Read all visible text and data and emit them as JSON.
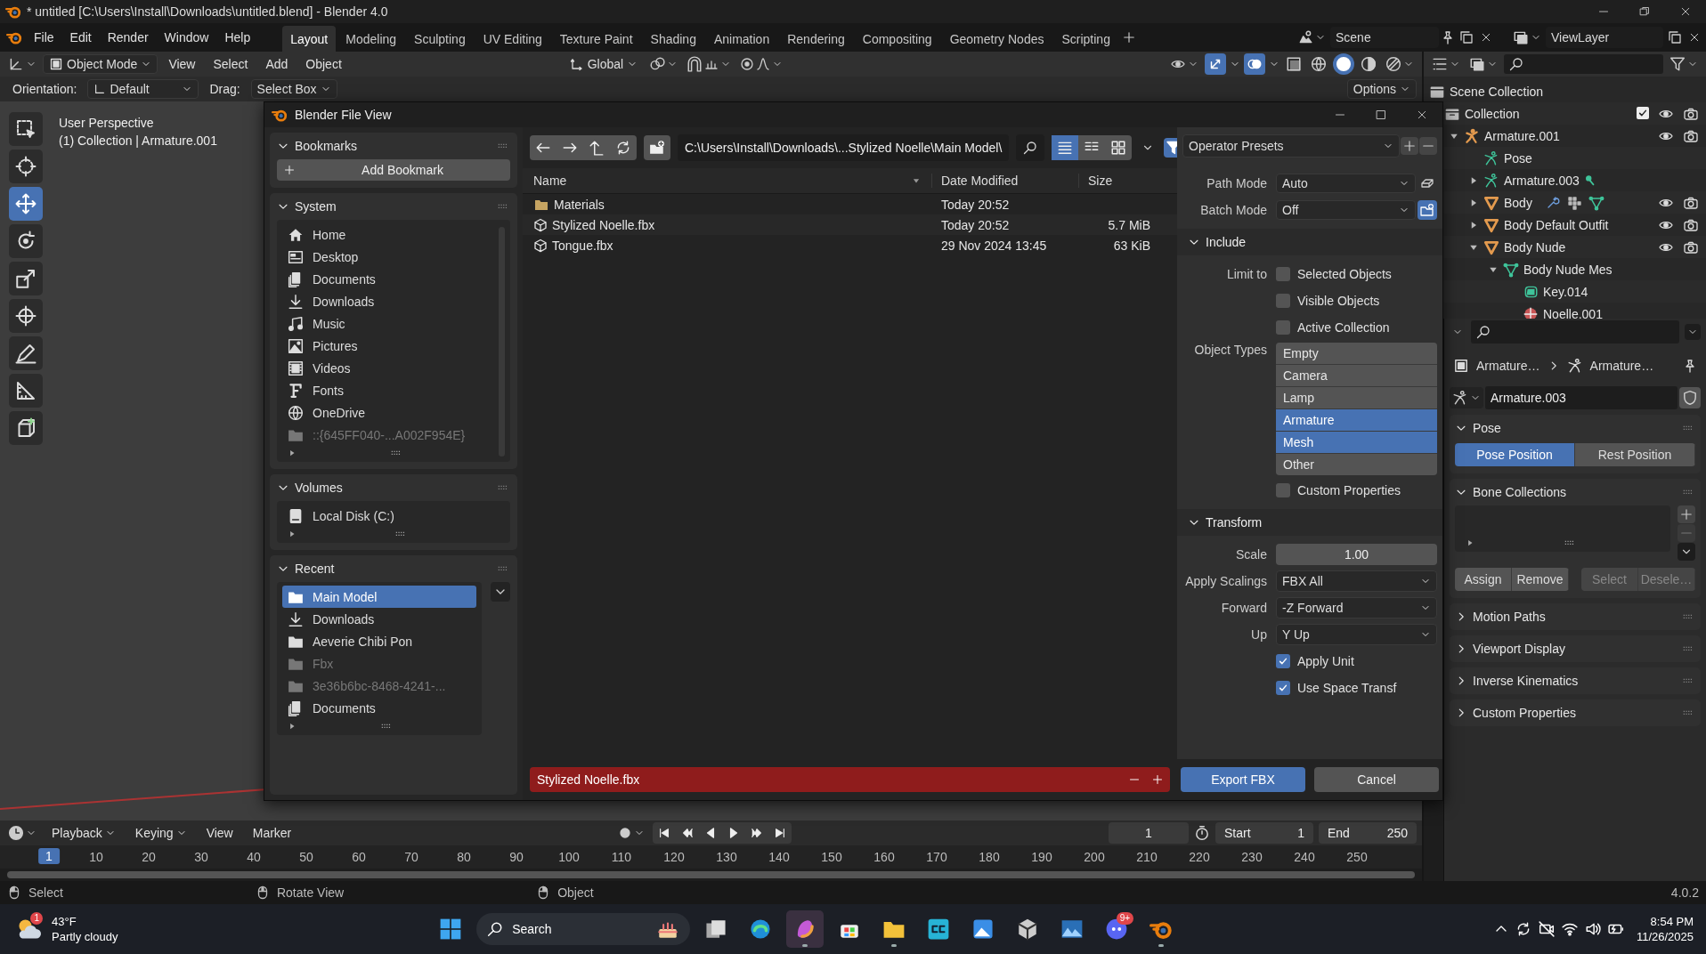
{
  "window": {
    "title": "* untitled [C:\\Users\\Install\\Downloads\\untitled.blend] - Blender 4.0"
  },
  "menu": [
    "File",
    "Edit",
    "Render",
    "Window",
    "Help"
  ],
  "workspaces": [
    {
      "label": "Layout",
      "selected": true
    },
    {
      "label": "Modeling",
      "selected": false
    },
    {
      "label": "Sculpting",
      "selected": false
    },
    {
      "label": "UV Editing",
      "selected": false
    },
    {
      "label": "Texture Paint",
      "selected": false
    },
    {
      "label": "Shading",
      "selected": false
    },
    {
      "label": "Animation",
      "selected": false
    },
    {
      "label": "Rendering",
      "selected": false
    },
    {
      "label": "Compositing",
      "selected": false
    },
    {
      "label": "Geometry Nodes",
      "selected": false
    },
    {
      "label": "Scripting",
      "selected": false
    }
  ],
  "scene": "Scene",
  "view_layer": "ViewLayer",
  "viewport_header": {
    "mode": "Object Mode",
    "menus": [
      "View",
      "Select",
      "Add",
      "Object"
    ],
    "orientation": "Global"
  },
  "tool_settings": {
    "orientation_label": "Orientation:",
    "orientation": "Default",
    "drag_label": "Drag:",
    "drag": "Select Box",
    "options": "Options"
  },
  "tools": [
    {
      "kind": "select",
      "selected": false
    },
    {
      "kind": "cursor",
      "selected": false
    },
    {
      "kind": "move",
      "selected": true
    },
    {
      "kind": "rotate",
      "selected": false
    },
    {
      "kind": "scale",
      "selected": false
    },
    {
      "kind": "transform",
      "selected": false
    },
    {
      "kind": "annotate",
      "selected": false
    },
    {
      "kind": "measure",
      "selected": false
    },
    {
      "kind": "add_cube",
      "selected": false
    }
  ],
  "viewport": {
    "perspective": "User Perspective",
    "context": "(1) Collection | Armature.001"
  },
  "file_dialog": {
    "title": "Blender File View",
    "bookmarks": {
      "title": "Bookmarks",
      "expanded": true,
      "add": "Add Bookmark"
    },
    "system": {
      "title": "System",
      "expanded": true,
      "items": [
        {
          "label": "Home",
          "kind": "home",
          "disabled": false
        },
        {
          "label": "Desktop",
          "kind": "desktop",
          "disabled": false
        },
        {
          "label": "Documents",
          "kind": "documents",
          "disabled": false
        },
        {
          "label": "Downloads",
          "kind": "download",
          "disabled": false
        },
        {
          "label": "Music",
          "kind": "music",
          "disabled": false
        },
        {
          "label": "Pictures",
          "kind": "picture",
          "disabled": false
        },
        {
          "label": "Videos",
          "kind": "video",
          "disabled": false
        },
        {
          "label": "Fonts",
          "kind": "font",
          "disabled": false
        },
        {
          "label": "OneDrive",
          "kind": "globe",
          "disabled": false
        },
        {
          "label": "::{645FF040-...A002F954E}",
          "kind": "folder",
          "disabled": true
        }
      ]
    },
    "volumes": {
      "title": "Volumes",
      "expanded": true,
      "items": [
        {
          "label": "Local Disk (C:)",
          "kind": "disk",
          "disabled": false
        }
      ]
    },
    "recent": {
      "title": "Recent",
      "expanded": true,
      "items": [
        {
          "label": "Main Model",
          "kind": "folder",
          "selected": true,
          "disabled": false
        },
        {
          "label": "Downloads",
          "kind": "download",
          "selected": false,
          "disabled": false
        },
        {
          "label": "Aeverie Chibi Pon",
          "kind": "folder",
          "selected": false,
          "disabled": false
        },
        {
          "label": "Fbx",
          "kind": "folder",
          "selected": false,
          "disabled": true
        },
        {
          "label": "3e36b6bc-8468-4241-...",
          "kind": "folder",
          "selected": false,
          "disabled": true
        },
        {
          "label": "Documents",
          "kind": "documents",
          "selected": false,
          "disabled": false
        }
      ]
    },
    "path": "C:\\Users\\Install\\Downloads\\...Stylized Noelle\\Main Model\\",
    "columns": [
      "Name",
      "Date Modified",
      "Size"
    ],
    "files": [
      {
        "name": "Materials",
        "kind": "folder",
        "date": "Today 20:52"
      },
      {
        "name": "Stylized Noelle.fbx",
        "kind": "file",
        "date": "Today 20:52",
        "size": "5.7 MiB"
      },
      {
        "name": "Tongue.fbx",
        "kind": "file",
        "date": "29 Nov 2024 13:45",
        "size": "63 KiB"
      }
    ],
    "presets": "Operator Presets",
    "path_mode": {
      "label": "Path Mode",
      "value": "Auto"
    },
    "batch_mode": {
      "label": "Batch Mode",
      "value": "Off"
    },
    "include": {
      "title": "Include",
      "expanded": true,
      "limit_label": "Limit to",
      "limits": [
        {
          "label": "Selected Objects",
          "checked": false
        },
        {
          "label": "Visible Objects",
          "checked": false
        },
        {
          "label": "Active Collection",
          "checked": false
        }
      ],
      "types_label": "Object Types",
      "types": [
        {
          "label": "Empty",
          "selected": false
        },
        {
          "label": "Camera",
          "selected": false
        },
        {
          "label": "Lamp",
          "selected": false
        },
        {
          "label": "Armature",
          "selected": true
        },
        {
          "label": "Mesh",
          "selected": true
        },
        {
          "label": "Other",
          "selected": false
        }
      ],
      "custom_properties": {
        "label": "Custom Properties",
        "checked": false
      }
    },
    "transform": {
      "title": "Transform",
      "expanded": true,
      "fields": [
        {
          "kind": "number",
          "label": "Scale",
          "value": "1.00"
        },
        {
          "kind": "dropdown",
          "label": "Apply Scalings",
          "value": "FBX All"
        },
        {
          "kind": "dropdown",
          "label": "Forward",
          "value": "-Z Forward"
        },
        {
          "kind": "dropdown",
          "label": "Up",
          "value": "Y Up"
        }
      ],
      "checks": [
        {
          "label": "Apply Unit",
          "checked": true
        },
        {
          "label": "Use Space Transf",
          "checked": true
        }
      ]
    },
    "filename": "Stylized Noelle.fbx",
    "file_exists": true,
    "buttons": [
      {
        "label": "Export FBX",
        "primary": true
      },
      {
        "label": "Cancel",
        "primary": false
      }
    ]
  },
  "outliner": {
    "root": "Scene Collection",
    "tree": [
      {
        "label": "Collection",
        "kind": "collection",
        "checked": true,
        "show_toggles": true,
        "children": [
          {
            "label": "Armature.001",
            "kind": "armature",
            "expanded": true,
            "show_toggles": true,
            "children": [
              {
                "label": "Pose",
                "kind": "pose"
              },
              {
                "label": "Armature.003",
                "kind": "armature_data",
                "expanded": false,
                "bone_badge": true
              },
              {
                "label": "Body",
                "kind": "mesh_object",
                "expanded": false,
                "show_toggles": true,
                "modifiers": true
              },
              {
                "label": "Body Default Outfit",
                "kind": "mesh_object",
                "expanded": false,
                "show_toggles": true
              },
              {
                "label": "Body Nude",
                "kind": "mesh_object",
                "expanded": true,
                "show_toggles": true,
                "children": [
                  {
                    "label": "Body Nude Mes",
                    "kind": "mesh_data",
                    "expanded": true,
                    "children": [
                      {
                        "label": "Key.014",
                        "kind": "shape_key"
                      },
                      {
                        "label": "Noelle.001",
                        "kind": "material"
                      }
                    ]
                  }
                ]
              }
            ]
          }
        ]
      }
    ]
  },
  "properties": {
    "breadcrumb": [
      "Armature…",
      "Armature…"
    ],
    "data_name": "Armature.003",
    "panels": [
      {
        "title": "Pose",
        "expanded": true,
        "kind": "pose",
        "buttons": [
          {
            "label": "Pose Position",
            "selected": true
          },
          {
            "label": "Rest Position",
            "selected": false
          }
        ]
      },
      {
        "title": "Bone Collections",
        "expanded": true,
        "kind": "bone_collections",
        "buttons": [
          {
            "label": "Assign",
            "disabled": false
          },
          {
            "label": "Remove",
            "disabled": false
          },
          {
            "label": "Select",
            "disabled": true
          },
          {
            "label": "Desele…",
            "disabled": true
          }
        ]
      },
      {
        "title": "Motion Paths",
        "expanded": false
      },
      {
        "title": "Viewport Display",
        "expanded": false
      },
      {
        "title": "Inverse Kinematics",
        "expanded": false
      },
      {
        "title": "Custom Properties",
        "expanded": false
      }
    ]
  },
  "timeline": {
    "menus": [
      {
        "label": "Playback",
        "dropdown": true
      },
      {
        "label": "Keying",
        "dropdown": true
      },
      {
        "label": "View",
        "dropdown": false
      },
      {
        "label": "Marker",
        "dropdown": false
      }
    ],
    "current_frame": "1",
    "start_label": "Start",
    "start": "1",
    "end_label": "End",
    "end": "250",
    "ticks": [
      "1",
      "10",
      "20",
      "30",
      "40",
      "50",
      "60",
      "70",
      "80",
      "90",
      "100",
      "110",
      "120",
      "130",
      "140",
      "150",
      "160",
      "170",
      "180",
      "190",
      "200",
      "210",
      "220",
      "230",
      "240",
      "250"
    ]
  },
  "status_bar": {
    "items": [
      {
        "label": "Select",
        "kind": "mouse_left"
      },
      {
        "label": "Rotate View",
        "kind": "mouse_middle"
      },
      {
        "label": "Object",
        "kind": "mouse_right"
      }
    ],
    "version": "4.0.2"
  },
  "taskbar": {
    "weather": {
      "temp": "43°F",
      "condition": "Partly cloudy",
      "badge": "1"
    },
    "search": "Search",
    "apps": [
      {
        "kind": "task_view",
        "running": false
      },
      {
        "kind": "browser",
        "running": false
      },
      {
        "kind": "assistant",
        "running": true
      },
      {
        "kind": "store",
        "running": false
      },
      {
        "kind": "folder",
        "running": true
      },
      {
        "kind": "cc",
        "running": false
      },
      {
        "kind": "photos",
        "running": false
      },
      {
        "kind": "cube",
        "running": false
      },
      {
        "kind": "mountains",
        "running": false
      },
      {
        "kind": "chat",
        "running": false,
        "badge": "9+"
      },
      {
        "kind": "app3d",
        "running": true
      }
    ],
    "time": "8:54 PM",
    "date": "11/26/2025"
  }
}
